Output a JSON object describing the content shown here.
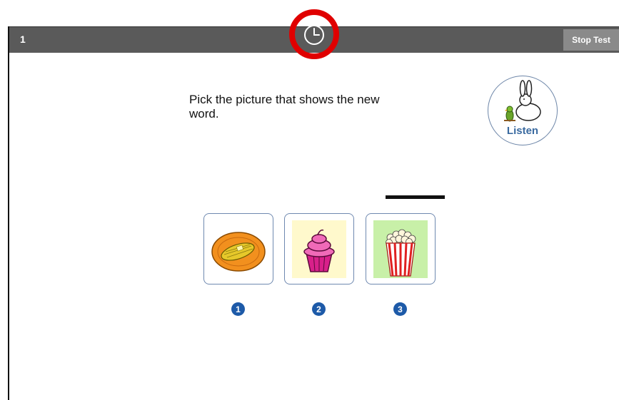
{
  "header": {
    "question_number": "1",
    "stop_label": "Stop Test",
    "timer_icon": "clock-icon",
    "highlight_color": "#e00000"
  },
  "question": {
    "prompt": "Pick the picture that shows the new word.",
    "listen_label": "Listen"
  },
  "choices": [
    {
      "number": "1",
      "icon": "corn-on-plate"
    },
    {
      "number": "2",
      "icon": "cupcake"
    },
    {
      "number": "3",
      "icon": "popcorn"
    }
  ],
  "colors": {
    "header_bg": "#5a5a5a",
    "stop_bg": "#8a8a8a",
    "number_badge": "#1d5aa8",
    "card_border": "#6f89b0"
  }
}
